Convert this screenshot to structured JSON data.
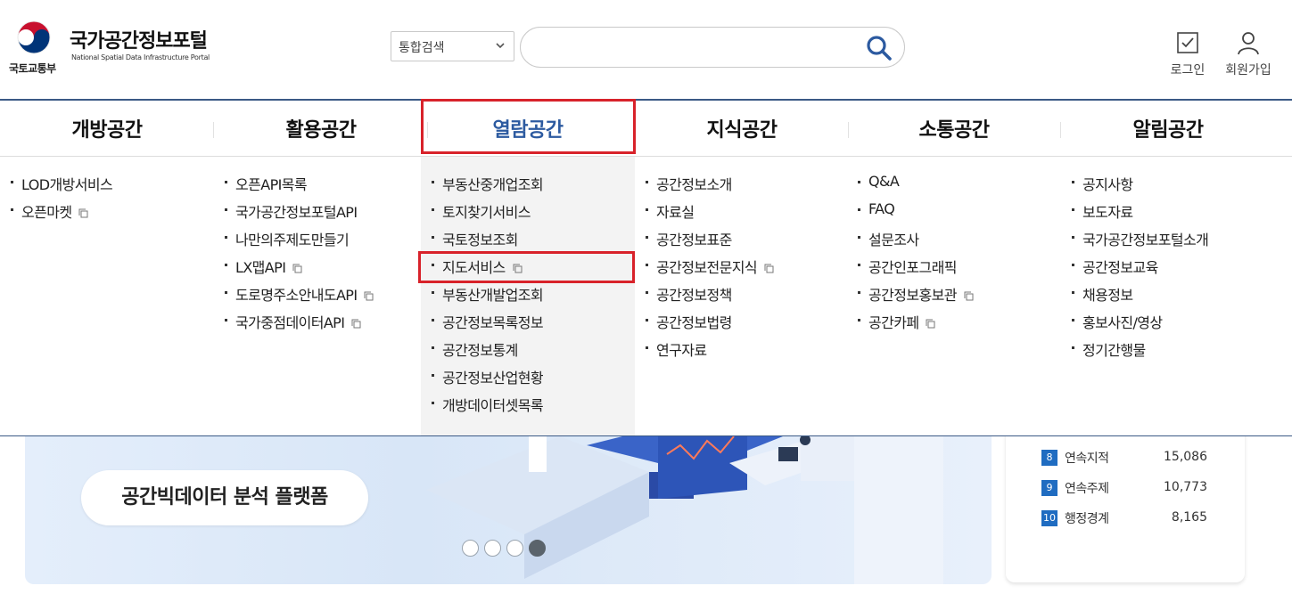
{
  "header": {
    "ministry": "국토교통부",
    "site_title": "국가공간정보포털",
    "site_subtitle": "National Spatial Data Infrastructure Portal",
    "search_scope": "통합검색",
    "search_placeholder": "",
    "login": "로그인",
    "join": "회원가입"
  },
  "gnb": [
    {
      "label": "개방공간",
      "items": [
        {
          "label": "LOD개방서비스",
          "external": false
        },
        {
          "label": "오픈마켓",
          "external": true
        }
      ]
    },
    {
      "label": "활용공간",
      "items": [
        {
          "label": "오픈API목록",
          "external": false
        },
        {
          "label": "국가공간정보포털API",
          "external": false
        },
        {
          "label": "나만의주제도만들기",
          "external": false
        },
        {
          "label": "LX맵API",
          "external": true
        },
        {
          "label": "도로명주소안내도API",
          "external": true
        },
        {
          "label": "국가중점데이터API",
          "external": true
        }
      ]
    },
    {
      "label": "열람공간",
      "items": [
        {
          "label": "부동산중개업조회",
          "external": false
        },
        {
          "label": "토지찾기서비스",
          "external": false
        },
        {
          "label": "국토정보조회",
          "external": false
        },
        {
          "label": "지도서비스",
          "external": true
        },
        {
          "label": "부동산개발업조회",
          "external": false
        },
        {
          "label": "공간정보목록정보",
          "external": false
        },
        {
          "label": "공간정보통계",
          "external": false
        },
        {
          "label": "공간정보산업현황",
          "external": false
        },
        {
          "label": "개방데이터셋목록",
          "external": false
        }
      ]
    },
    {
      "label": "지식공간",
      "items": [
        {
          "label": "공간정보소개",
          "external": false
        },
        {
          "label": "자료실",
          "external": false
        },
        {
          "label": "공간정보표준",
          "external": false
        },
        {
          "label": "공간정보전문지식",
          "external": true
        },
        {
          "label": "공간정보정책",
          "external": false
        },
        {
          "label": "공간정보법령",
          "external": false
        },
        {
          "label": "연구자료",
          "external": false
        }
      ]
    },
    {
      "label": "소통공간",
      "items": [
        {
          "label": "Q&A",
          "external": false
        },
        {
          "label": "FAQ",
          "external": false
        },
        {
          "label": "설문조사",
          "external": false
        },
        {
          "label": "공간인포그래픽",
          "external": false
        },
        {
          "label": "공간정보홍보관",
          "external": true
        },
        {
          "label": "공간카페",
          "external": true
        }
      ]
    },
    {
      "label": "알림공간",
      "items": [
        {
          "label": "공지사항",
          "external": false
        },
        {
          "label": "보도자료",
          "external": false
        },
        {
          "label": "국가공간정보포털소개",
          "external": false
        },
        {
          "label": "공간정보교육",
          "external": false
        },
        {
          "label": "채용정보",
          "external": false
        },
        {
          "label": "홍보사진/영상",
          "external": false
        },
        {
          "label": "정기간행물",
          "external": false
        }
      ]
    }
  ],
  "active_menu_index": 2,
  "highlighted_item": "지도서비스",
  "banner": {
    "title": "공간빅데이터 분석 플랫폼",
    "slide_count": 4,
    "active_slide": 4
  },
  "ranking": [
    {
      "rank": "8",
      "name": "연속지적",
      "value": "15,086"
    },
    {
      "rank": "9",
      "name": "연속주제",
      "value": "10,773"
    },
    {
      "rank": "10",
      "name": "행정경계",
      "value": "8,165"
    }
  ],
  "colors": {
    "accent": "#2c5aa0",
    "highlight_box": "#d8222a",
    "rank_badge": "#1f6cc1"
  }
}
